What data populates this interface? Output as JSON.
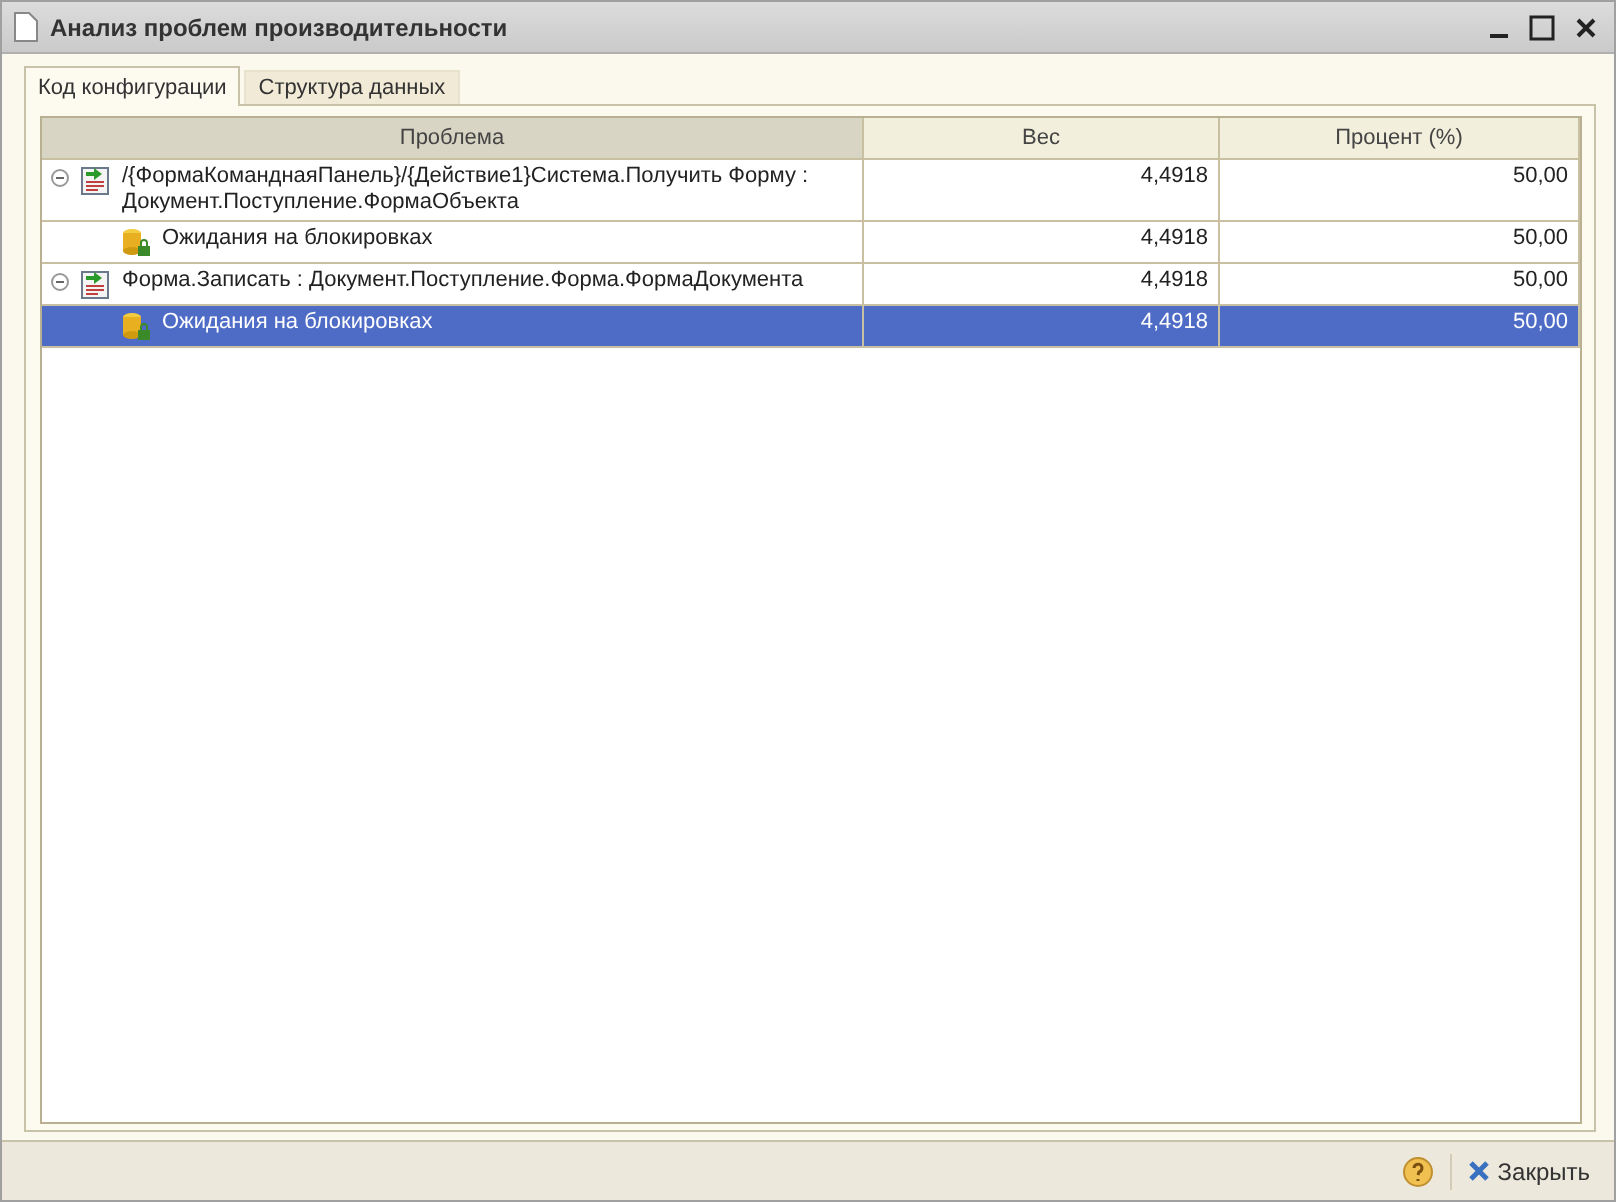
{
  "window": {
    "title": "Анализ проблем производительности"
  },
  "tabs": [
    {
      "label": "Код конфигурации",
      "selected": true
    },
    {
      "label": "Структура данных",
      "selected": false
    }
  ],
  "table": {
    "columns": [
      "Проблема",
      "Вес",
      "Процент (%)"
    ],
    "rows": [
      {
        "kind": "operation",
        "problem": "/{ФормаКоманднаяПанель}/{Действие1}Система.Получить Форму : Документ.Поступление.ФормаОбъекта",
        "weight": "4,4918",
        "percent": "50,00",
        "expanded": true,
        "selected": false,
        "children": [
          {
            "kind": "lock",
            "problem": "Ожидания на блокировках",
            "weight": "4,4918",
            "percent": "50,00",
            "selected": false
          }
        ]
      },
      {
        "kind": "operation",
        "problem": "Форма.Записать : Документ.Поступление.Форма.ФормаДокумента",
        "weight": "4,4918",
        "percent": "50,00",
        "expanded": true,
        "selected": false,
        "children": [
          {
            "kind": "lock",
            "problem": "Ожидания на блокировках",
            "weight": "4,4918",
            "percent": "50,00",
            "selected": true
          }
        ]
      }
    ]
  },
  "footer": {
    "close_label": "Закрыть"
  }
}
